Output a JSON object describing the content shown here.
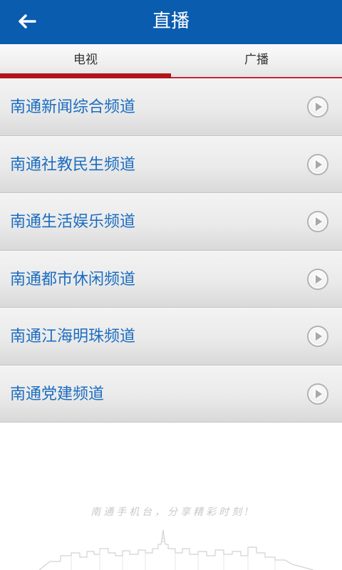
{
  "header": {
    "title": "直播",
    "back_icon": "arrow-left-icon"
  },
  "tabs": [
    {
      "label": "电视",
      "active": true
    },
    {
      "label": "广播",
      "active": false
    }
  ],
  "channels": [
    {
      "name": "南通新闻综合频道",
      "icon": "play-circle-icon"
    },
    {
      "name": "南通社教民生频道",
      "icon": "play-circle-icon"
    },
    {
      "name": "南通生活娱乐频道",
      "icon": "play-circle-icon"
    },
    {
      "name": "南通都市休闲频道",
      "icon": "play-circle-icon"
    },
    {
      "name": "南通江海明珠频道",
      "icon": "play-circle-icon"
    },
    {
      "name": "南通党建频道",
      "icon": "play-circle-icon"
    }
  ],
  "footer": {
    "slogan": "南通手机台，分享精彩时刻!",
    "graphic": "city-skyline-graphic"
  },
  "colors": {
    "header_bg": "#0a5caf",
    "channel_text": "#1b6dc1",
    "tab_indicator": "#b3141b",
    "tab_line": "#c4262d"
  }
}
